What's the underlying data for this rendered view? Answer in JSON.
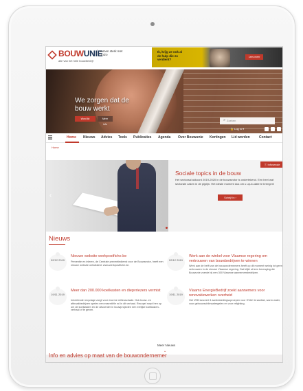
{
  "site": {
    "logo_bouw": "BOUW",
    "logo_unie": "UNIE",
    "tagline": "alle van het hele bouwbedrijf",
    "slogan": "samen sterk met Unizo"
  },
  "ad": {
    "text": "Ik, krijg ze ook al de hulp die zo verdient?",
    "cta": "Lees meer"
  },
  "hero": {
    "title": "We zorgen dat de bouw werkt",
    "button_primary": "Word lid",
    "button_secondary": "Meer info",
    "search_placeholder": "Zoeken",
    "login": "Log in"
  },
  "nav": {
    "home": "Home",
    "nieuws": "Nieuws",
    "advies": "Advies",
    "tools": "Tools",
    "publicaties": "Publicaties",
    "agenda": "Agenda",
    "over": "Over Bouwunie",
    "kortingen": "Kortingen",
    "lid": "Lid worden",
    "contact": "Contact"
  },
  "breadcrumb": "Home",
  "slider": {
    "tag": "Infosessie",
    "title": "Sociale topics in de bouw",
    "text": "Het sectoraal akkoord 2019-2020 in de bouwsector is ondertekend. Een heel wat sectorale zaken in de pijplijn. Het ideale moment dus om u up-to-date te brengen!",
    "button": "Schrijf in"
  },
  "news": {
    "heading": "Nieuws",
    "items": [
      {
        "date": "02/12 2019",
        "title": "Nieuwe website werkpostfiche.be",
        "body": "Preventie en inleren, de Centrale preventiedienst voor de Bouwsector, heeft een nieuwe website ontwikkeld: www.werkpostfiche.be."
      },
      {
        "date": "02/12 2019",
        "title": "Werk aan de winkel voor Vlaamse regering om vertrouwen van bouwbedrijven te winnen",
        "body": "Werk aan de helft van de bouwondernemers heeft op dit moment weinig tot geen vertrouwen in de nieuwe Vlaamse regering. Dat blijkt uit een bevraging die Bouwunie voerde bij een 300 Vlaamse aannemersbedrijven."
      },
      {
        "date": "19/11 2019",
        "title": "Meer dan 200.000 koelkasten en diepvriezers vermist",
        "body": "Inrichtende recyclage zorgt voor enorme milieuschade. Ook bouw- en afbraakbedrijven spelen een essentiële rol in dit verhaal. Recupel roept hen op om de koelkasten en de uitvoerder in bouwprojecten een eerlijke koelkasten-verhaal of te geven."
      },
      {
        "date": "19/11 2019",
        "title": "Vlaams EnergieBedrijf zoekt aannemers voor renovatiewerken overheid",
        "body": "Het VEB lanceert 3 aanbestedingsoproepen voor HVAC & sanitair, warm water, voor gebouwschilmaatregelen en voor relighting."
      }
    ],
    "more": "Meer Nieuws"
  },
  "info_title": "Info en advies op maat van de bouwondernemer"
}
